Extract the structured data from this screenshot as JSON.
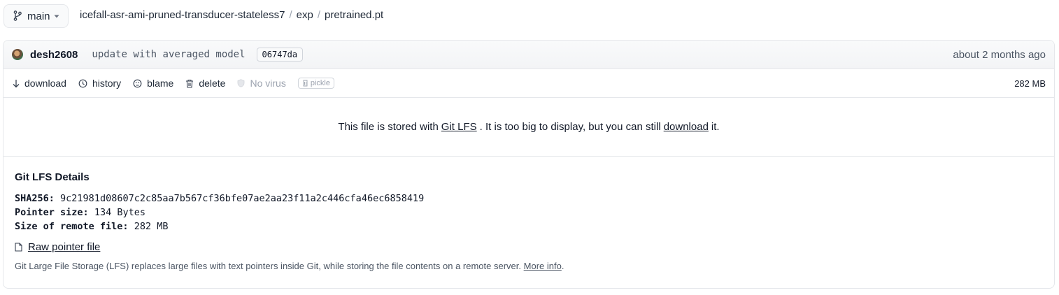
{
  "branch": {
    "label": "main"
  },
  "breadcrumb": {
    "repo": "icefall-asr-ami-pruned-transducer-stateless7",
    "sep": "/",
    "folder": "exp",
    "file": "pretrained.pt"
  },
  "commit": {
    "author": "desh2608",
    "message": "update with averaged model",
    "sha": "06747da",
    "time": "about 2 months ago"
  },
  "actions": {
    "download": "download",
    "history": "history",
    "blame": "blame",
    "delete": "delete",
    "virus": "No virus",
    "pickle": "pickle",
    "size": "282 MB"
  },
  "lfs_message": {
    "before": "This file is stored with",
    "link1": "Git LFS",
    "middle": ". It is too big to display, but you can still",
    "link2": "download",
    "after": "it."
  },
  "lfs_details": {
    "title": "Git LFS Details",
    "sha_label": "SHA256:",
    "sha_value": "9c21981d08607c2c85aa7b567cf36bfe07ae2aa23f11a2c446cfa46ec6858419",
    "pointer_label": "Pointer size:",
    "pointer_value": "134 Bytes",
    "remote_label": "Size of remote file:",
    "remote_value": "282 MB",
    "raw_link": "Raw pointer file",
    "note": "Git Large File Storage (LFS) replaces large files with text pointers inside Git, while storing the file contents on a remote server.",
    "more_info": "More info",
    "note_end": "."
  }
}
